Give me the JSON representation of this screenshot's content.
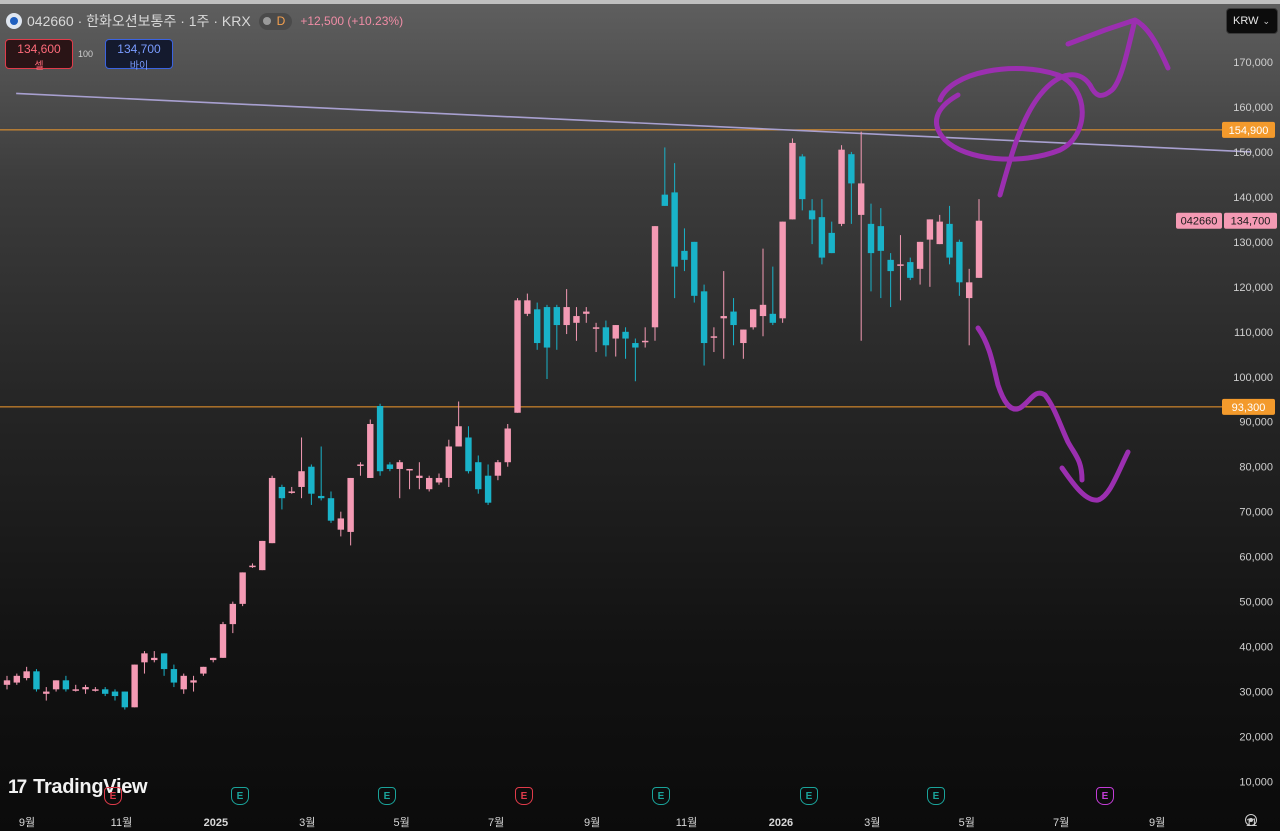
{
  "header": {
    "title": "042660 · 한화오션보통주 · 1주 · KRX",
    "resolution_badge": "D",
    "change": "+12,500 (+10.23%)"
  },
  "quote": {
    "sell_price": "134,600",
    "sell_label": "셀",
    "spread": "100",
    "buy_price": "134,700",
    "buy_label": "바이"
  },
  "currency": {
    "label": "KRW"
  },
  "branding": {
    "logo_mark": "17",
    "logo_text": "TradingView"
  },
  "earnings_markers": [
    {
      "label": "E",
      "color": "#1aa39a"
    },
    {
      "label": "E",
      "color": "#1aa39a"
    },
    {
      "label": "E",
      "color": "#e03b4a"
    },
    {
      "label": "E",
      "color": "#1aa39a"
    },
    {
      "label": "E",
      "color": "#1aa39a"
    },
    {
      "label": "E",
      "color": "#1aa39a"
    },
    {
      "label": "E",
      "color": "#c23cd6"
    }
  ],
  "colors": {
    "up": "#f49ab4",
    "down": "#19b3c9",
    "horizontal_line": "#f39a2c",
    "trendline": "#a8a0d0",
    "annotation": "#9b2fb0",
    "last_price_label_bg": "#f49ab4"
  },
  "chart_data": {
    "type": "candlestick",
    "title": "042660 · 한화오션보통주 · 1주 · KRX",
    "interval": "1 week",
    "y_axis_ticks": [
      "10,000",
      "20,000",
      "30,000",
      "40,000",
      "50,000",
      "60,000",
      "70,000",
      "80,000",
      "90,000",
      "100,000",
      "110,000",
      "120,000",
      "130,000",
      "140,000",
      "150,000",
      "160,000",
      "170,000"
    ],
    "y_tick_values": [
      10000,
      20000,
      30000,
      40000,
      50000,
      60000,
      70000,
      80000,
      90000,
      100000,
      110000,
      120000,
      130000,
      140000,
      150000,
      160000,
      170000
    ],
    "ylim": [
      7000,
      176000
    ],
    "x_axis_ticks": [
      {
        "label": "9월",
        "date": "2024-09-01"
      },
      {
        "label": "11월",
        "date": "2024-11-01"
      },
      {
        "label": "2025",
        "date": "2025-01-01",
        "bold": true
      },
      {
        "label": "3월",
        "date": "2025-03-01"
      },
      {
        "label": "5월",
        "date": "2025-05-01"
      },
      {
        "label": "7월",
        "date": "2025-07-01"
      },
      {
        "label": "9월",
        "date": "2025-09-01"
      },
      {
        "label": "11월",
        "date": "2025-11-01"
      },
      {
        "label": "2026",
        "date": "2026-01-01",
        "bold": true
      },
      {
        "label": "3월",
        "date": "2026-03-01"
      },
      {
        "label": "5월",
        "date": "2026-05-01"
      },
      {
        "label": "7월",
        "date": "2026-07-01"
      },
      {
        "label": "9월",
        "date": "2026-09-01"
      },
      {
        "label": "11",
        "date": "2026-11-01"
      }
    ],
    "candles": [
      {
        "o": 31500,
        "h": 33500,
        "l": 30500,
        "c": 32500
      },
      {
        "o": 32000,
        "h": 34000,
        "l": 31500,
        "c": 33500
      },
      {
        "o": 33000,
        "h": 35500,
        "l": 32500,
        "c": 34500
      },
      {
        "o": 34500,
        "h": 35000,
        "l": 30000,
        "c": 30500
      },
      {
        "o": 29500,
        "h": 31000,
        "l": 28000,
        "c": 30000
      },
      {
        "o": 30500,
        "h": 32500,
        "l": 30000,
        "c": 32500
      },
      {
        "o": 32500,
        "h": 33500,
        "l": 30000,
        "c": 30500
      },
      {
        "o": 30500,
        "h": 31500,
        "l": 30000,
        "c": 30500
      },
      {
        "o": 30500,
        "h": 31500,
        "l": 29500,
        "c": 31000
      },
      {
        "o": 30500,
        "h": 31000,
        "l": 30000,
        "c": 30500
      },
      {
        "o": 30500,
        "h": 31000,
        "l": 29000,
        "c": 29500
      },
      {
        "o": 30000,
        "h": 30500,
        "l": 28000,
        "c": 29000
      },
      {
        "o": 30000,
        "h": 30000,
        "l": 26000,
        "c": 26500
      },
      {
        "o": 26500,
        "h": 36000,
        "l": 26500,
        "c": 36000
      },
      {
        "o": 36500,
        "h": 39000,
        "l": 34000,
        "c": 38500
      },
      {
        "o": 37000,
        "h": 39000,
        "l": 36500,
        "c": 37500
      },
      {
        "o": 38500,
        "h": 38500,
        "l": 33500,
        "c": 35000
      },
      {
        "o": 35000,
        "h": 36000,
        "l": 31000,
        "c": 32000
      },
      {
        "o": 30500,
        "h": 34000,
        "l": 29500,
        "c": 33500
      },
      {
        "o": 32000,
        "h": 33500,
        "l": 30000,
        "c": 32500
      },
      {
        "o": 34000,
        "h": 35500,
        "l": 33500,
        "c": 35500
      },
      {
        "o": 37000,
        "h": 37500,
        "l": 36500,
        "c": 37500
      },
      {
        "o": 37500,
        "h": 45500,
        "l": 37500,
        "c": 45000
      },
      {
        "o": 45000,
        "h": 50000,
        "l": 43000,
        "c": 49500
      },
      {
        "o": 49500,
        "h": 56500,
        "l": 49000,
        "c": 56500
      },
      {
        "o": 58000,
        "h": 58500,
        "l": 57500,
        "c": 58000
      },
      {
        "o": 57000,
        "h": 63500,
        "l": 57000,
        "c": 63500
      },
      {
        "o": 63000,
        "h": 78000,
        "l": 63000,
        "c": 77500
      },
      {
        "o": 75500,
        "h": 76000,
        "l": 70500,
        "c": 73000
      },
      {
        "o": 74500,
        "h": 75500,
        "l": 74000,
        "c": 74500
      },
      {
        "o": 75500,
        "h": 86500,
        "l": 73000,
        "c": 79000
      },
      {
        "o": 80000,
        "h": 80500,
        "l": 71500,
        "c": 74000
      },
      {
        "o": 73500,
        "h": 84500,
        "l": 72500,
        "c": 73000
      },
      {
        "o": 73000,
        "h": 74500,
        "l": 67500,
        "c": 68000
      },
      {
        "o": 66000,
        "h": 70000,
        "l": 64500,
        "c": 68500
      },
      {
        "o": 65500,
        "h": 77500,
        "l": 62500,
        "c": 77500
      },
      {
        "o": 80500,
        "h": 81000,
        "l": 78000,
        "c": 80500
      },
      {
        "o": 77500,
        "h": 90500,
        "l": 77500,
        "c": 89500
      },
      {
        "o": 93500,
        "h": 94000,
        "l": 78000,
        "c": 79000
      },
      {
        "o": 80500,
        "h": 81000,
        "l": 79000,
        "c": 79500
      },
      {
        "o": 79500,
        "h": 81500,
        "l": 73000,
        "c": 81000
      },
      {
        "o": 79500,
        "h": 79500,
        "l": 75000,
        "c": 79500
      },
      {
        "o": 77500,
        "h": 81000,
        "l": 75000,
        "c": 78000
      },
      {
        "o": 75000,
        "h": 78000,
        "l": 74500,
        "c": 77500
      },
      {
        "o": 76500,
        "h": 78500,
        "l": 76000,
        "c": 77500
      },
      {
        "o": 77500,
        "h": 86000,
        "l": 75500,
        "c": 84500
      },
      {
        "o": 84500,
        "h": 94500,
        "l": 84500,
        "c": 89000
      },
      {
        "o": 86500,
        "h": 89000,
        "l": 78500,
        "c": 79000
      },
      {
        "o": 81000,
        "h": 82500,
        "l": 74000,
        "c": 75000
      },
      {
        "o": 78000,
        "h": 80500,
        "l": 71500,
        "c": 72000
      },
      {
        "o": 78000,
        "h": 81500,
        "l": 77000,
        "c": 81000
      },
      {
        "o": 81000,
        "h": 89500,
        "l": 80000,
        "c": 88500
      },
      {
        "o": 92000,
        "h": 117500,
        "l": 92000,
        "c": 117000
      },
      {
        "o": 114000,
        "h": 118500,
        "l": 113500,
        "c": 117000
      },
      {
        "o": 115000,
        "h": 116500,
        "l": 106000,
        "c": 107500
      },
      {
        "o": 115500,
        "h": 116000,
        "l": 99500,
        "c": 106500
      },
      {
        "o": 115500,
        "h": 116000,
        "l": 106000,
        "c": 111500
      },
      {
        "o": 111500,
        "h": 119500,
        "l": 109500,
        "c": 115500
      },
      {
        "o": 112000,
        "h": 115500,
        "l": 108000,
        "c": 113500
      },
      {
        "o": 114000,
        "h": 115500,
        "l": 112000,
        "c": 114500
      },
      {
        "o": 111000,
        "h": 112000,
        "l": 105500,
        "c": 111000
      },
      {
        "o": 111000,
        "h": 112500,
        "l": 104500,
        "c": 107000
      },
      {
        "o": 108500,
        "h": 111500,
        "l": 104500,
        "c": 111500
      },
      {
        "o": 110000,
        "h": 111000,
        "l": 104000,
        "c": 108500
      },
      {
        "o": 107500,
        "h": 108500,
        "l": 99000,
        "c": 106500
      },
      {
        "o": 108000,
        "h": 111000,
        "l": 106500,
        "c": 108000
      },
      {
        "o": 111000,
        "h": 116000,
        "l": 108000,
        "c": 133500
      },
      {
        "o": 140500,
        "h": 151000,
        "l": 140000,
        "c": 138000
      },
      {
        "o": 141000,
        "h": 147500,
        "l": 117500,
        "c": 124500
      },
      {
        "o": 128000,
        "h": 133000,
        "l": 123500,
        "c": 126000
      },
      {
        "o": 130000,
        "h": 128500,
        "l": 116500,
        "c": 118000
      },
      {
        "o": 119000,
        "h": 120500,
        "l": 102500,
        "c": 107500
      },
      {
        "o": 109000,
        "h": 111000,
        "l": 105500,
        "c": 109000
      },
      {
        "o": 113000,
        "h": 123500,
        "l": 104000,
        "c": 113500
      },
      {
        "o": 114500,
        "h": 117500,
        "l": 107000,
        "c": 111500
      },
      {
        "o": 107500,
        "h": 106500,
        "l": 104000,
        "c": 110500
      },
      {
        "o": 111000,
        "h": 114000,
        "l": 110500,
        "c": 115000
      },
      {
        "o": 113500,
        "h": 128500,
        "l": 109000,
        "c": 116000
      },
      {
        "o": 114000,
        "h": 124500,
        "l": 111500,
        "c": 112000
      },
      {
        "o": 113000,
        "h": 134500,
        "l": 112000,
        "c": 134500
      },
      {
        "o": 135000,
        "h": 153000,
        "l": 135000,
        "c": 152000
      },
      {
        "o": 149000,
        "h": 149500,
        "l": 137000,
        "c": 139500
      },
      {
        "o": 137000,
        "h": 139500,
        "l": 129500,
        "c": 135000
      },
      {
        "o": 135500,
        "h": 139500,
        "l": 125000,
        "c": 126500
      },
      {
        "o": 132000,
        "h": 134500,
        "l": 128500,
        "c": 127500
      },
      {
        "o": 134000,
        "h": 151500,
        "l": 133500,
        "c": 150500
      },
      {
        "o": 149500,
        "h": 150000,
        "l": 134000,
        "c": 143000
      },
      {
        "o": 136000,
        "h": 154500,
        "l": 108000,
        "c": 143000
      },
      {
        "o": 134000,
        "h": 138500,
        "l": 119000,
        "c": 127500
      },
      {
        "o": 133500,
        "h": 137500,
        "l": 117500,
        "c": 128000
      },
      {
        "o": 126000,
        "h": 127500,
        "l": 115500,
        "c": 123500
      },
      {
        "o": 125000,
        "h": 131500,
        "l": 117000,
        "c": 125000
      },
      {
        "o": 125500,
        "h": 126500,
        "l": 121500,
        "c": 122000
      },
      {
        "o": 124000,
        "h": 130000,
        "l": 120500,
        "c": 130000
      },
      {
        "o": 130500,
        "h": 133500,
        "l": 120000,
        "c": 135000
      },
      {
        "o": 129500,
        "h": 136000,
        "l": 134000,
        "c": 134500
      },
      {
        "o": 134000,
        "h": 138000,
        "l": 125000,
        "c": 126500
      },
      {
        "o": 130000,
        "h": 130500,
        "l": 118000,
        "c": 121000
      },
      {
        "o": 117500,
        "h": 124000,
        "l": 107000,
        "c": 121000
      },
      {
        "o": 122000,
        "h": 139500,
        "l": 122000,
        "c": 134700
      }
    ],
    "horizontal_lines": [
      {
        "value": 154900,
        "label": "154,900"
      },
      {
        "value": 93300,
        "label": "93,300"
      }
    ],
    "trendline": {
      "x1": "2024-08-25",
      "y1": 163000,
      "x2": "2026-11-01",
      "y2": 150000
    },
    "last_price": {
      "value": 134700,
      "label": "134,700",
      "symbol": "042660"
    }
  }
}
